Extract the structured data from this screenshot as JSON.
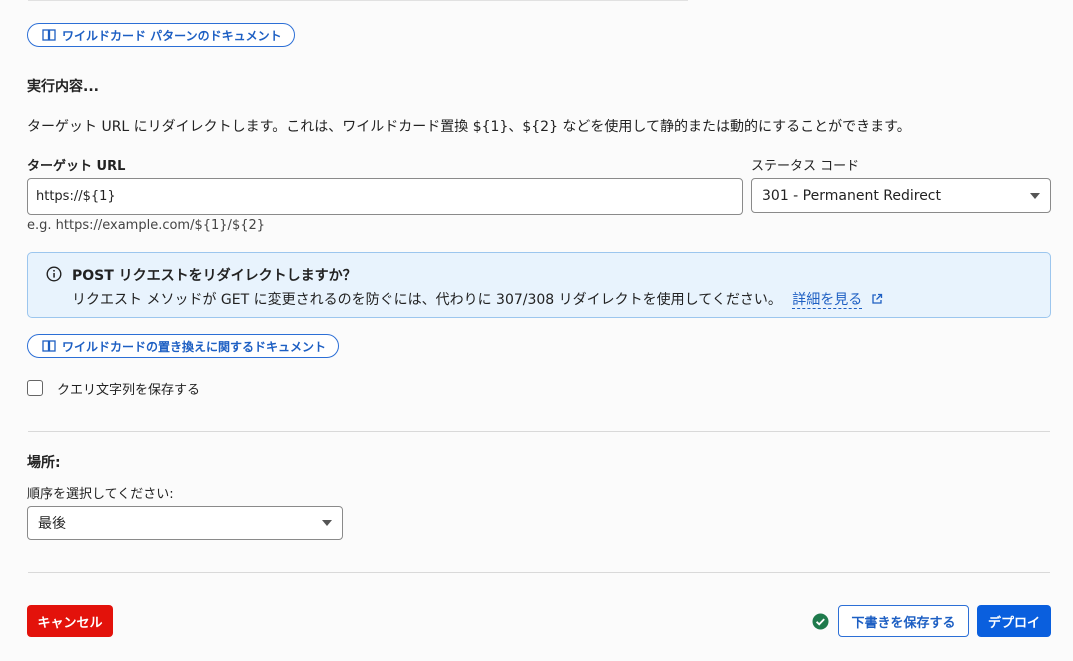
{
  "top_cut_text": "ワイルドカード パターンのドキュメント",
  "doc_buttons": {
    "wildcard_pattern": "ワイルドカード パターンのドキュメント",
    "wildcard_replacement": "ワイルドカードの置き換えに関するドキュメント"
  },
  "action": {
    "heading": "実行内容...",
    "description": "ターゲット URL にリダイレクトします。これは、ワイルドカード置換 ${1}、${2} などを使用して静的または動的にすることができます。",
    "target_url_label": "ターゲット URL",
    "target_url_value": "https://${1}",
    "target_url_hint": "e.g. https://example.com/${1}/${2}",
    "status_code_label": "ステータス コード",
    "status_code_value": "301 - Permanent Redirect"
  },
  "info": {
    "title": "POST リクエストをリダイレクトしますか？",
    "body": "リクエスト メソッドが GET に変更されるのを防ぐには、代わりに 307/308 リダイレクトを使用してください。",
    "link": "詳細を見る"
  },
  "preserve_query": {
    "label": "クエリ文字列を保存する",
    "checked": false
  },
  "location": {
    "heading": "場所:",
    "order_label": "順序を選択してください:",
    "order_value": "最後"
  },
  "footer": {
    "cancel": "キャンセル",
    "save_draft": "下書きを保存する",
    "deploy": "デプロイ"
  },
  "colors": {
    "accent": "#1d5fc3",
    "danger": "#e3120b",
    "primary": "#0a5fde",
    "success": "#1f7a4c"
  }
}
